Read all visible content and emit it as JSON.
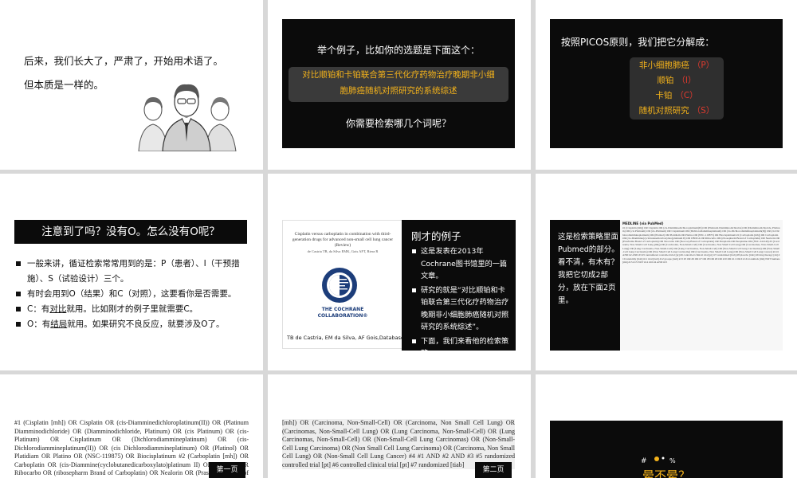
{
  "slide1": {
    "line1": "后来，我们长大了，严肃了，开始用术语了。",
    "line2": "但本质是一样的。"
  },
  "slide2": {
    "intro": "举个例子，比如你的选题是下面这个：",
    "topic_line1": "对比顺铂和卡铂联合第三代化疗药物治疗晚期非小细",
    "topic_line2": "胞肺癌随机对照研究的系统综述",
    "question": "你需要检索哪几个词呢？"
  },
  "slide3": {
    "intro": "按照PICOS原则，我们把它分解成：",
    "items": [
      {
        "term": "非小细胞肺癌",
        "code": "（P）"
      },
      {
        "term": "顺铂",
        "code": "（I）"
      },
      {
        "term": "卡铂",
        "code": "（C）"
      },
      {
        "term": "随机对照研究",
        "code": "（S）"
      }
    ]
  },
  "slide4": {
    "header": "注意到了吗？没有O。怎么没有O呢？",
    "bullets": [
      {
        "text": "一般来讲，循证检索常常用到的是：P（患者）、I（干预措施）、S（试验设计）三个。"
      },
      {
        "text": "有时会用到O（结果）和C（对照），这要看你是否需要。"
      },
      {
        "pre": "C：有",
        "u": "对比",
        "post": "就用。比如刚才的例子里就需要C。"
      },
      {
        "pre": "O：有",
        "u": "结局",
        "post": "就用。如果研究不良反应，就要涉及O了。"
      }
    ]
  },
  "slide5": {
    "paper_title": "Cisplatin versus carboplatin in combination with third-generation drugs for advanced non-small cell lung cancer (Review)",
    "paper_authors": "de Castria TB, da Silva EMK, Gois AFT, Riera R",
    "logo_line1": "THE COCHRANE",
    "logo_line2": "COLLABORATION®",
    "citation": "TB de Castria, EM da Silva, AF Gois,Database Syst Rev, 2013",
    "heading": "刚才的例子",
    "bullets": [
      "这是发表在2013年Cochrane图书馆里的一篇文章。",
      "研究的就是“对比顺铂和卡铂联合第三代化疗药物治疗晚期非小细胞肺癌随机对照研究的系统综述”。",
      "下面，我们来看他的检索策略。"
    ]
  },
  "slide6": {
    "text": "这是检索策略里面Pubmed的部分。看不清，有木有？我把它切成2部分，放在下面2页里。",
    "shot_header": "MEDLINE (via PubMed)",
    "shot_body": "#1 (Cisplatin [mh]) OR Cisplatin OR (cis-Diamminedichloroplatinum(II)) OR (Platinum Diamminodichloride) OR (Diamminodichloride, Platinum) OR (cis Platinum) OR (cis-Platinum) OR Cisplatinum OR (Dichlorodiammineplatinum) OR (cis-Dichlorodiammineplatinum(II)) OR (cis Dichlorodiammineplatinum) OR (Platinol) OR Platidiam OR Platino OR (NSC-119875) OR Biocisplatinum #2 (Carboplatin [mh]) OR Carboplatin OR (cis-Diammine(cyclobutanedicarboxylato)platinum II) OR CBDCA OR Ribocarbo OR (ribosepharm Brand of Carboplatin) OR Nealorin OR (Prasfarma Brand of Carboplatin) OR Neocarbo OR (Neocorp Brand of Carboplatin) OR Paraplatin OR Paraplatine OR (NSC-241240) #3 (Carcinoma, Non-Small-Cell Lung [mh]) OR (Carcinoma, Non-Small-Cell) OR (Carcinoma, Non Small Cell Lung) OR (Carcinomas, Non-Small-Cell Lung) OR (Lung Carcinoma, Non-Small-Cell) OR (Lung Carcinomas, Non-Small-Cell) OR (Non-Small-Cell Lung Carcinomas) OR (Non-Small-Cell Lung Carcinoma) OR (Non Small Cell Lung Carcinoma) OR (Carcinoma, Non Small Cell Lung) OR (Non-Small Cell Lung Cancer) #4 #1 AND #2 AND #3 #5 randomized controlled trial [pt] #6 controlled clinical trial [pt] #7 randomized [tiab] #8 placebo [tiab] #9 drug therapy [sh] #10 randomly [tiab] #11 trial [tiab] #12 groups [tiab] #13 #5 OR #6 OR #7 OR #8 OR #9 OR #10 OR #11 OR #12 #14 animals [mh] NOT humans [mh] #15 #13 NOT #14 #16 #4 AND #15"
  },
  "slide7": {
    "text": "#1 (Cisplatin [mh]) OR Cisplatin OR (cis-Diamminedichloroplatinum(II)) OR (Platinum Diamminodichloride) OR (Diamminodichloride, Platinum) OR (cis Platinum) OR (cis-Platinum) OR Cisplatinum OR (Dichlorodiammineplatinum) OR (cis-Dichlorodiammineplatinum(II)) OR (cis Dichlorodiammineplatinum) OR (Platinol) OR Platidiam OR Platino OR (NSC-119875) OR Biocisplatinum #2 (Carboplatin [mh]) OR Carboplatin OR (cis-Diammine(cyclobutanedicarboxylato)platinum II) OR CBDCA OR Ribocarbo OR (ribosepharm Brand of Carboplatin) OR Nealorin OR (Prasfarma Brand of Carboplatin) OR Neocarbo OR (Neocorp Brand of Carboplatin) OR Paraplatin",
    "page_label": "第一页"
  },
  "slide8": {
    "text": "[mh]) OR (Carcinoma, Non-Small-Cell) OR (Carcinoma, Non Small Cell Lung) OR (Carcinomas, Non-Small-Cell Lung) OR (Lung Carcinoma, Non-Small-Cell) OR (Lung Carcinomas, Non-Small-Cell) OR (Non-Small-Cell Lung Carcinomas) OR (Non-Small-Cell Lung Carcinoma) OR (Non Small Cell Lung Carcinoma) OR (Carcinoma, Non Small Cell Lung) OR (Non-Small Cell Lung Cancer) #4 #1 AND #2 AND #3 #5 randomized controlled trial [pt] #6 controlled clinical trial [pt] #7 randomized [tiab]",
    "page_label": "第二页"
  },
  "slide9": {
    "title": "晕不晕？"
  },
  "colors": {
    "accent": "#f3b21b",
    "code_red": "#e03a2f",
    "panel": "#0b0b0b",
    "cochrane_blue": "#1c3d7a"
  }
}
